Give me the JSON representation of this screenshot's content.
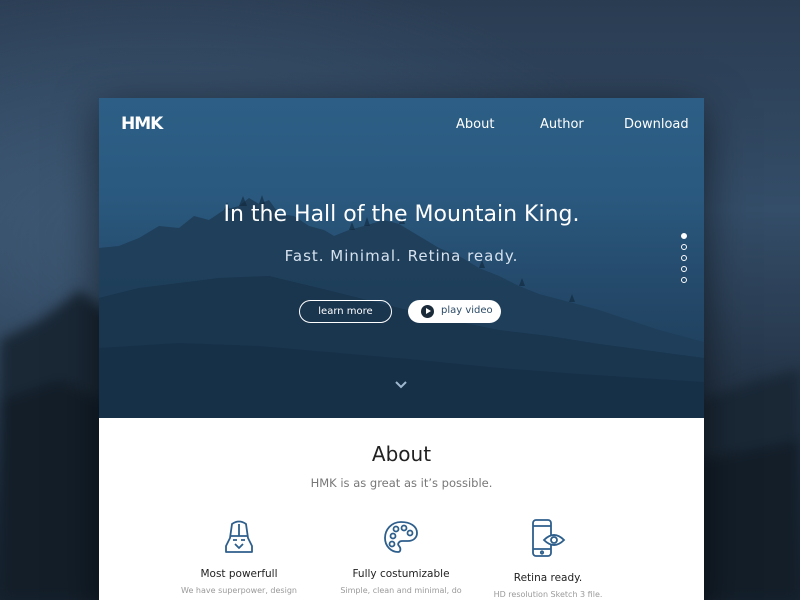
{
  "nav": {
    "logo": "HMK",
    "links": [
      "About",
      "Author",
      "Download"
    ]
  },
  "hero": {
    "title": "In the Hall of the Mountain King.",
    "subtitle": "Fast. Minimal. Retina ready.",
    "learn_more_label": "learn more",
    "play_video_label": "play video",
    "pager": {
      "count": 5,
      "active_index": 0
    }
  },
  "about": {
    "title": "About",
    "subtitle": "HMK is as great as it’s possible.",
    "features": [
      {
        "icon": "helmet-icon",
        "title": "Most powerfull",
        "desc": "We have superpower, design"
      },
      {
        "icon": "palette-icon",
        "title": "Fully costumizable",
        "desc": "Simple, clean and minimal, do"
      },
      {
        "icon": "phone-eye-icon",
        "title": "Retina ready.",
        "desc": "HD resolution Sketch 3 file."
      }
    ]
  },
  "colors": {
    "hero_blue": "#2a597f",
    "icon_blue": "#2e5f8c",
    "text_dark": "#222222",
    "text_muted": "#777777"
  }
}
